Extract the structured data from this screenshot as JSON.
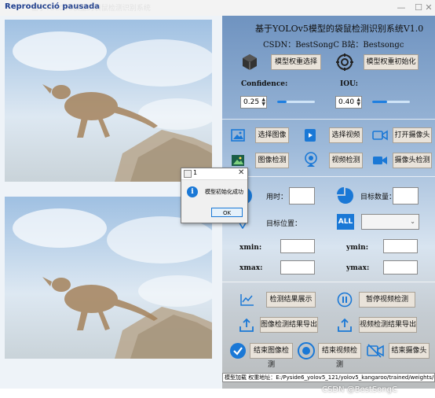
{
  "window": {
    "title": "Reproducció pausada",
    "title_ghost": "基于YOLOv5模型的袋鼠检测识别系统"
  },
  "header": {
    "title": "基于YOLOv5模型的袋鼠检测识别系统V1.0",
    "csdn": "CSDN：BestSongC",
    "bilibili": "B站：Bestsongc"
  },
  "model": {
    "select_label": "模型权重选择",
    "init_label": "模型权重初始化"
  },
  "params": {
    "confidence_label": "Confidence:",
    "confidence_value": "0.25",
    "confidence_fraction": 0.25,
    "iou_label": "IOU:",
    "iou_value": "0.40",
    "iou_fraction": 0.4
  },
  "actions": {
    "select_image": "选择图像",
    "select_video": "选择视频",
    "open_camera": "打开摄像头",
    "image_detect": "图像检测",
    "video_detect": "视频检测",
    "camera_detect": "摄像头检测"
  },
  "stats": {
    "time_label": "用时：",
    "count_label": "目标数量：",
    "position_label": "目标位置：",
    "all_text": "ALL",
    "xmin_label": "xmin:",
    "ymin_label": "ymin:",
    "xmax_label": "xmax:",
    "ymax_label": "ymax:"
  },
  "results": {
    "show_results": "检测结果展示",
    "pause_video": "暂停视频检测",
    "export_image": "图像检测结果导出",
    "export_video": "视频检测结果导出",
    "end_image": "结束图像检测",
    "end_video": "结束视频检测",
    "end_camera": "结束摄像头"
  },
  "dialog": {
    "title": "1",
    "message": "模型初始化成功",
    "ok": "OK"
  },
  "status": {
    "text": "模型加载  权重地址：E:/Pyside6_yolov5_121/yolov5_kangaroo/trained/weights/best.pt"
  },
  "watermark": "CSDN @BestSongC",
  "colors": {
    "accent": "#1e7fe0",
    "icon_blue": "#1a78d6",
    "button_bg": "#e9e3da"
  }
}
